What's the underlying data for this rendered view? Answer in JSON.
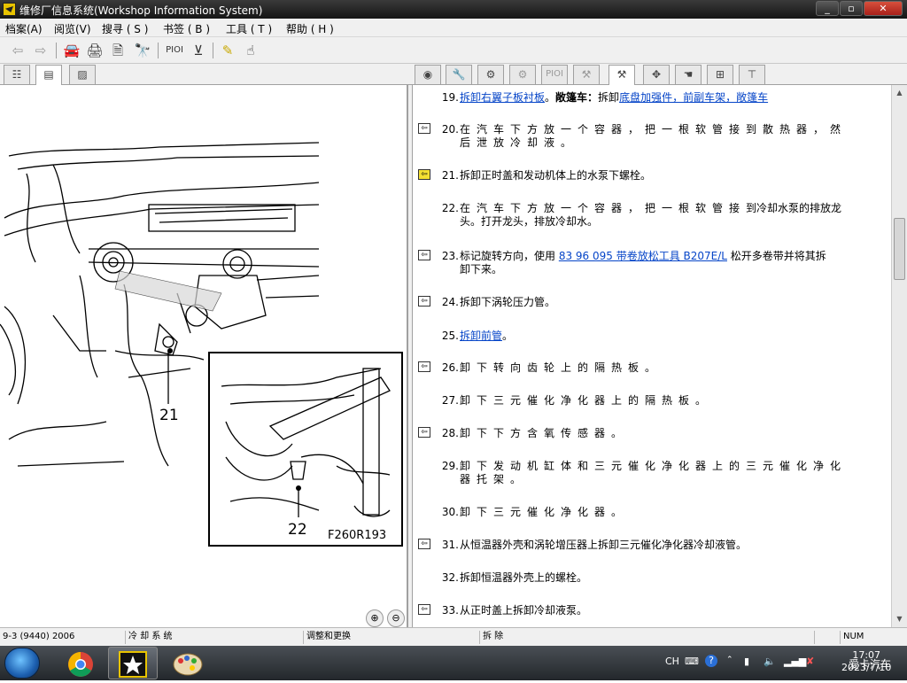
{
  "window": {
    "title": "维修厂信息系统(Workshop Information System)",
    "min": "_",
    "max": "▫",
    "close": "✕"
  },
  "menu": [
    "档案(A)",
    "阅览(V)",
    "搜寻 ( S )",
    "书签 ( B )",
    "工具 ( T )",
    "帮助 ( H )"
  ],
  "toolbar": {
    "piol_label": "PIOI"
  },
  "right_tabs": {
    "piol_label": "PIOI"
  },
  "figure": {
    "callout_21": "21",
    "callout_22": "22",
    "ref": "F260R193"
  },
  "steps": [
    {
      "num": "19.",
      "parts": [
        {
          "t": "拆卸右翼子板衬板",
          "link": true
        },
        {
          "t": "。"
        },
        {
          "t": "敞篷车：",
          "bold": true
        },
        {
          "t": "拆卸"
        },
        {
          "t": "底盘加强件，前副车架，敞篷车",
          "link": true
        }
      ]
    },
    {
      "num": "20.",
      "warn": true,
      "spaced": true,
      "line1": "在汽车下方放一个容器，把一根软管接到散热器，然",
      "line2": "后泄放冷却液。"
    },
    {
      "num": "21.",
      "warn": true,
      "highlight": true,
      "text": "拆卸正时盖和发动机体上的水泵下螺栓。"
    },
    {
      "num": "22.",
      "spaced": true,
      "line1": "在汽车下方放一个容器，把一根软管接",
      "line1b": "到冷却水泵的排放龙",
      "line2": "头。打开龙头，排放冷却水。"
    },
    {
      "num": "23.",
      "warn": true,
      "pre": "标记旋转方向，使用 ",
      "link": "83 96 095 带卷放松工具 B207E/L",
      "post": " 松开多卷带并将其拆",
      "line2": "卸下来。"
    },
    {
      "num": "24.",
      "warn": true,
      "text": "拆卸下涡轮压力管。"
    },
    {
      "num": "25.",
      "link": "拆卸前管",
      "post": "。"
    },
    {
      "num": "26.",
      "warn": true,
      "spaced": true,
      "text": "卸下转向齿轮上的隔热板。"
    },
    {
      "num": "27.",
      "spaced": true,
      "text": "卸下三元催化净化器上的隔热板。"
    },
    {
      "num": "28.",
      "warn": true,
      "spaced": true,
      "text": "卸下下方含氧传感器。"
    },
    {
      "num": "29.",
      "spaced": true,
      "line1": "卸下发动机缸体和三元催化净化器上的三元催化净化",
      "line2": "器托架。"
    },
    {
      "num": "30.",
      "spaced": true,
      "text": "卸下三元催化净化器。"
    },
    {
      "num": "31.",
      "warn": true,
      "text": "从恒温器外壳和涡轮增压器上拆卸三元催化净化器冷却液管。"
    },
    {
      "num": "32.",
      "text": "拆卸恒温器外壳上的螺栓。"
    },
    {
      "num": "33.",
      "warn": true,
      "text": "从正时盖上拆卸冷却液泵。"
    }
  ],
  "status": {
    "vehicle": "9-3 (9440) 2006",
    "system": "冷 却 系 统",
    "procedure": "调整和更换",
    "operation": "拆 除",
    "num": "NUM"
  },
  "taskbar": {
    "lang": "CH",
    "time": "17:07",
    "date": "2023/7/10"
  },
  "watermark": "爱卡汽车"
}
